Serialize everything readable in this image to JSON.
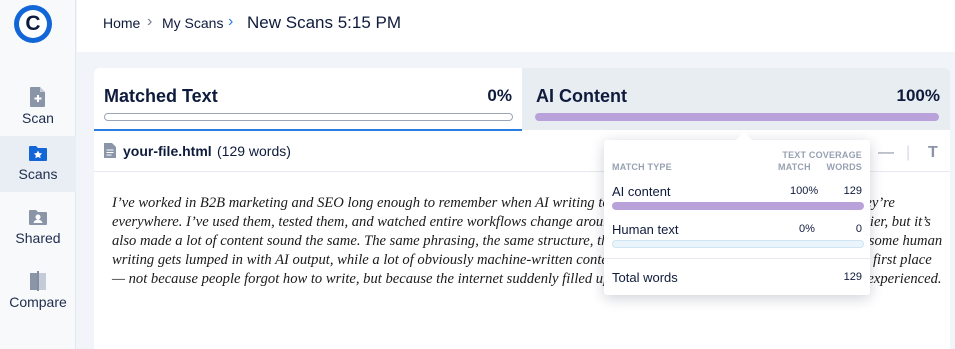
{
  "sidebar": {
    "logo_letter": "C",
    "items": [
      {
        "label": "Scan",
        "icon": "file-plus-icon"
      },
      {
        "label": "Scans",
        "icon": "folder-star-icon",
        "active": true
      },
      {
        "label": "Shared",
        "icon": "shared-user-icon"
      },
      {
        "label": "Compare",
        "icon": "compare-icon"
      }
    ]
  },
  "breadcrumb": {
    "home": "Home",
    "my_scans": "My Scans",
    "current": "New Scans 5:15 PM"
  },
  "tabs": {
    "matched": {
      "label": "Matched Text",
      "percent": "0%",
      "fill": 0
    },
    "ai": {
      "label": "AI Content",
      "percent": "100%",
      "fill": 1
    }
  },
  "file": {
    "name": "your-file.html",
    "words": "(129 words)"
  },
  "document_text": "I’ve worked in B2B marketing and SEO long enough to remember when AI writing tools weren’t part of the conversation. Now they’re everywhere. I’ve used them, tested them, and watched entire workflows change around them. They’ve made writing faster and easier, but it’s also made a lot of content sound the same. The same phrasing, the same structure, the same ‘safe’ tone. What’s frustrating is that some human writing gets lumped in with AI output, while a lot of obviously machine-written content still slips through. AI detectors exist in the first place — not because people forgot how to write, but because the internet suddenly filled up with content that feels optimized instead of experienced.",
  "popover": {
    "header_match_type": "MATCH TYPE",
    "header_text_coverage": "TEXT COVERAGE",
    "header_match": "MATCH",
    "header_words": "WORDS",
    "rows": [
      {
        "label": "AI content",
        "match": "100%",
        "words": "129",
        "fill": 1
      },
      {
        "label": "Human text",
        "match": "0%",
        "words": "0",
        "fill": 0
      }
    ],
    "total_label": "Total words",
    "total_value": "129"
  },
  "colors": {
    "brand_blue": "#1266d6",
    "ai_purple": "#b9a2d9",
    "human_light_blue": "#eaf4fb",
    "active_tab_blue": "#2a7de1"
  }
}
